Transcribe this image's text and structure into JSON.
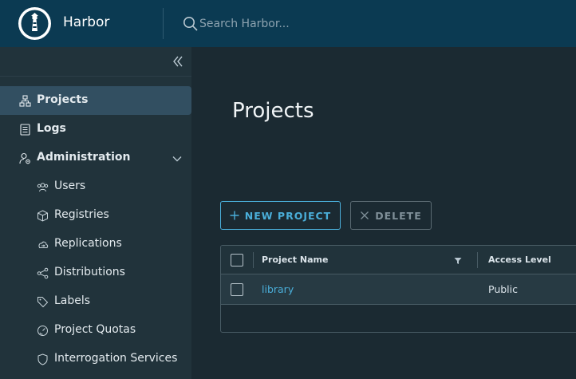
{
  "app": {
    "title": "Harbor"
  },
  "search": {
    "placeholder": "Search Harbor..."
  },
  "sidebar": {
    "items": [
      {
        "label": "Projects",
        "icon": "projects-icon",
        "active": true
      },
      {
        "label": "Logs",
        "icon": "logs-icon"
      },
      {
        "label": "Administration",
        "icon": "administration-icon",
        "expanded": true
      }
    ],
    "sub_items": [
      {
        "label": "Users",
        "icon": "users-icon"
      },
      {
        "label": "Registries",
        "icon": "registries-icon"
      },
      {
        "label": "Replications",
        "icon": "replications-icon"
      },
      {
        "label": "Distributions",
        "icon": "distributions-icon"
      },
      {
        "label": "Labels",
        "icon": "labels-icon"
      },
      {
        "label": "Project Quotas",
        "icon": "quotas-icon"
      },
      {
        "label": "Interrogation Services",
        "icon": "shield-icon"
      }
    ]
  },
  "main": {
    "title": "Projects",
    "buttons": {
      "new_project": "NEW PROJECT",
      "delete": "DELETE"
    },
    "table": {
      "columns": [
        "Project Name",
        "Access Level"
      ],
      "rows": [
        {
          "name": "library",
          "access": "Public"
        }
      ]
    }
  },
  "colors": {
    "header": "#0b3a52",
    "sidebar": "#21333b",
    "accent": "#4aaed9",
    "background": "#1b2a32"
  }
}
